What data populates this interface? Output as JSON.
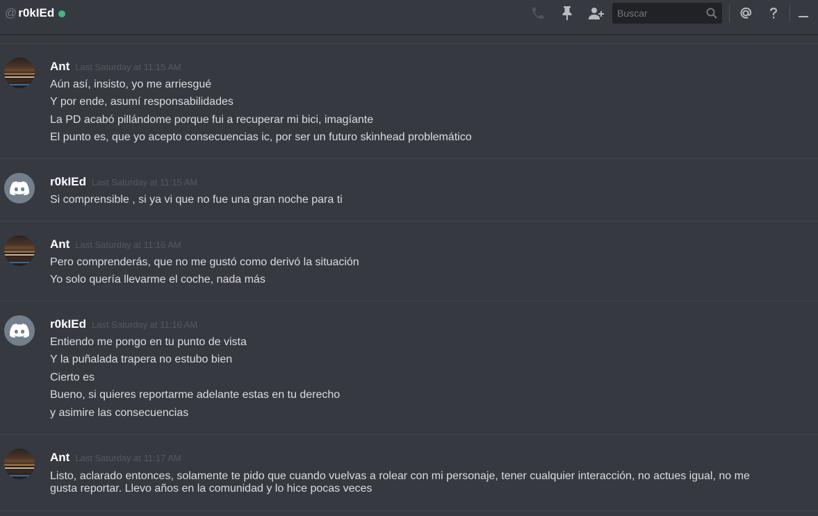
{
  "header": {
    "at_symbol": "@",
    "channel_name": "r0kIEd",
    "status_color": "#43b581",
    "icons": [
      "phone-icon",
      "pin-icon",
      "add-friend-icon",
      "search-icon",
      "mention-icon",
      "help-icon",
      "minimize-icon"
    ],
    "search_placeholder": "Buscar"
  },
  "messages": [
    {
      "author": "Ant",
      "timestamp": "Last Saturday at 11:15 AM",
      "avatar": "ant-avatar",
      "lines": [
        "Aún así, insisto, yo me arriesgué",
        "Y por ende, asumí responsabilidades",
        "La PD acabó pillándome porque fui a recuperar mi bici, imagíante",
        "El punto es, que yo acepto consecuencias ic, por ser un futuro skinhead problemático"
      ]
    },
    {
      "author": "r0kIEd",
      "timestamp": "Last Saturday at 11:15 AM",
      "avatar": "discord-default-avatar",
      "lines": [
        "Si comprensible , si ya vi que no fue una gran noche para ti"
      ]
    },
    {
      "author": "Ant",
      "timestamp": "Last Saturday at 11:16 AM",
      "avatar": "ant-avatar",
      "lines": [
        "Pero comprenderás, que no me gustó como derivó la situación",
        "Yo solo quería llevarme el coche, nada más"
      ]
    },
    {
      "author": "r0kIEd",
      "timestamp": "Last Saturday at 11:16 AM",
      "avatar": "discord-default-avatar",
      "lines": [
        "Entiendo me pongo en tu punto de vista",
        "Y la puñalada trapera no estubo bien",
        "Cierto es",
        "Bueno, si quieres reportarme adelante estas en tu derecho",
        "y asimire las consecuencias"
      ]
    },
    {
      "author": "Ant",
      "timestamp": "Last Saturday at 11:17 AM",
      "avatar": "ant-avatar",
      "lines": [
        "Listo, aclarado entonces, solamente te pido que cuando vuelvas a rolear con mi personaje, tener cualquier interacción, no actues igual, no me",
        "gusta reportar. Llevo años en la comunidad y lo hice pocas veces"
      ]
    }
  ]
}
